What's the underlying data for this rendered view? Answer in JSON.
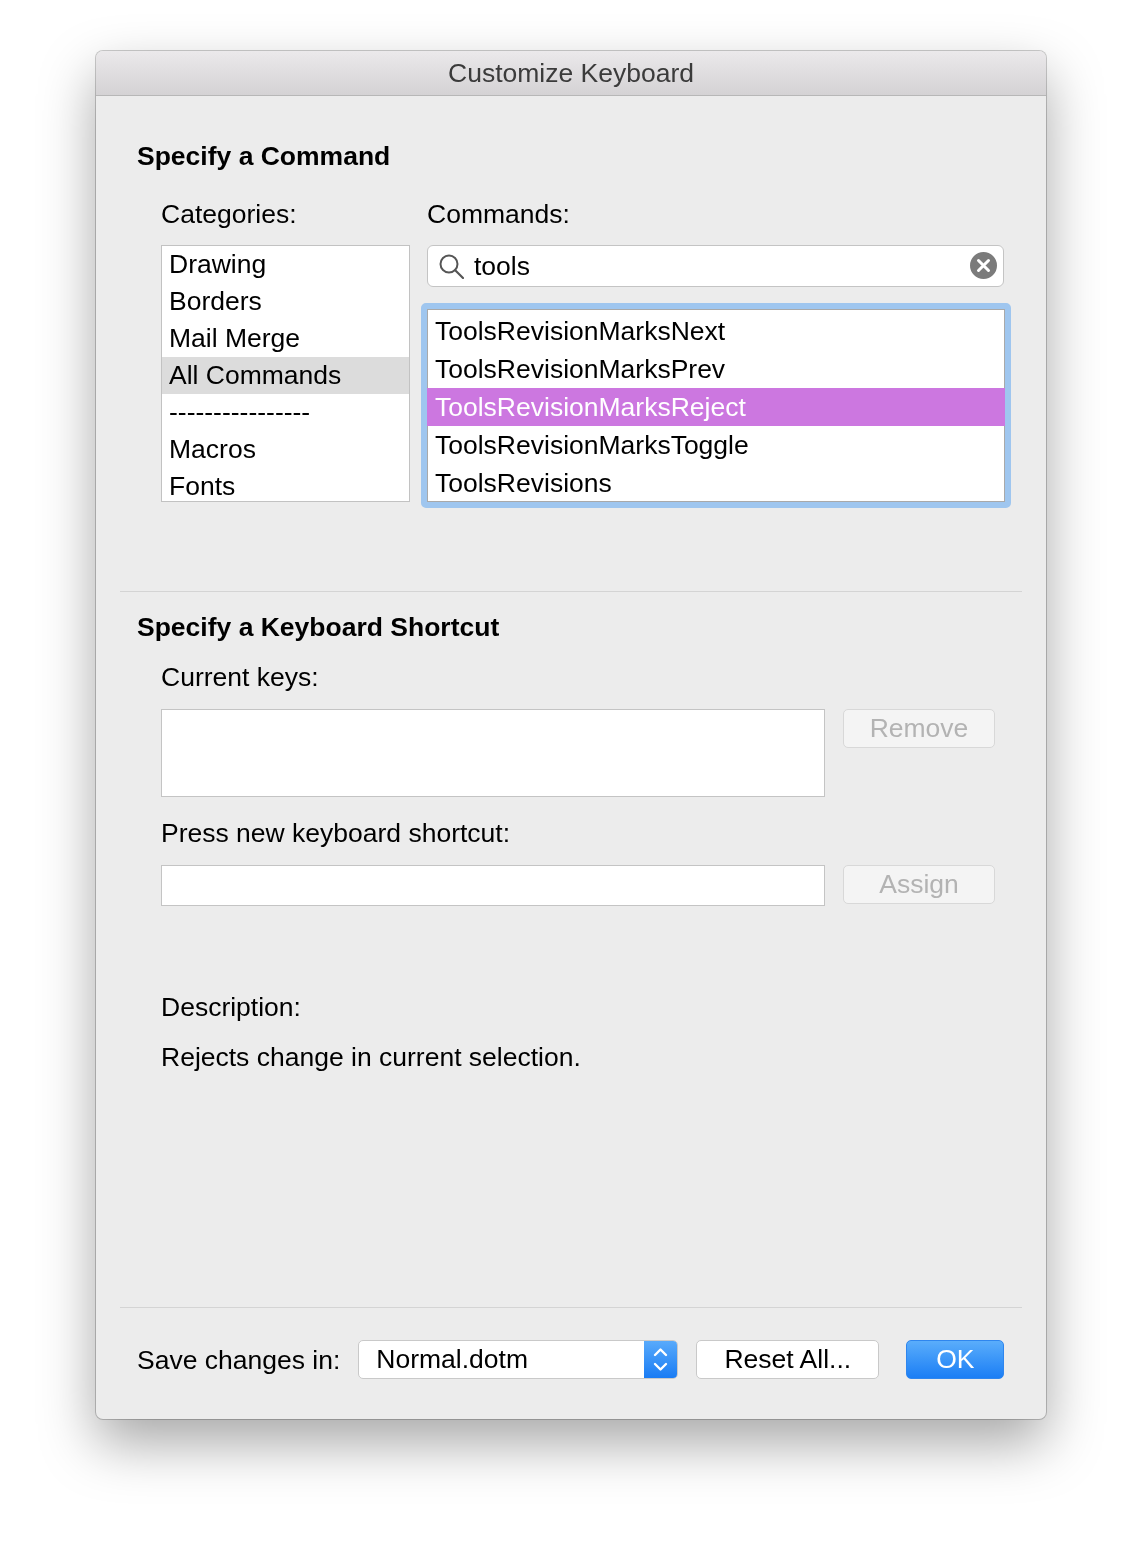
{
  "window": {
    "title": "Customize Keyboard"
  },
  "command_section": {
    "heading": "Specify a Command",
    "categories": {
      "label": "Categories:",
      "items": [
        {
          "label": "Drawing",
          "selected": false
        },
        {
          "label": "Borders",
          "selected": false
        },
        {
          "label": "Mail Merge",
          "selected": false
        },
        {
          "label": "All Commands",
          "selected": true
        },
        {
          "label": "----------------",
          "selected": false
        },
        {
          "label": "Macros",
          "selected": false
        },
        {
          "label": "Fonts",
          "selected": false
        }
      ]
    },
    "commands": {
      "label": "Commands:",
      "search": {
        "value": "tools"
      },
      "focused": true,
      "items": [
        {
          "label": "ToolsRevisionMarksNext",
          "selected": false
        },
        {
          "label": "ToolsRevisionMarksPrev",
          "selected": false
        },
        {
          "label": "ToolsRevisionMarksReject",
          "selected": true
        },
        {
          "label": "ToolsRevisionMarksToggle",
          "selected": false
        },
        {
          "label": "ToolsRevisions",
          "selected": false
        }
      ]
    }
  },
  "shortcut_section": {
    "heading": "Specify a Keyboard Shortcut",
    "current_keys": {
      "label": "Current keys:"
    },
    "remove_button": {
      "label": "Remove",
      "disabled": true
    },
    "new_shortcut": {
      "label": "Press new keyboard shortcut:"
    },
    "assign_button": {
      "label": "Assign",
      "disabled": true
    },
    "description": {
      "label": "Description:",
      "text": "Rejects change in current selection."
    }
  },
  "footer": {
    "save_in": {
      "label": "Save changes in:",
      "value": "Normal.dotm"
    },
    "buttons": [
      {
        "label": "Reset All...",
        "default": false
      },
      {
        "label": "OK",
        "default": true
      }
    ]
  }
}
